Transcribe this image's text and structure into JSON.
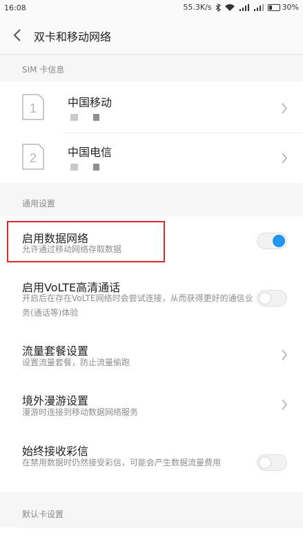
{
  "status_bar": {
    "time": "16:08",
    "speed": "55.3K/s",
    "battery": "30%",
    "battery_level": 0.3,
    "icons": [
      "bluetooth-icon",
      "wifi-icon",
      "signal-icon",
      "signal-4g-icon",
      "battery-icon"
    ]
  },
  "header": {
    "title": "双卡和移动网络"
  },
  "sim_section": {
    "header": "SIM 卡信息",
    "sims": [
      {
        "slot": "1",
        "name": "中国移动"
      },
      {
        "slot": "2",
        "name": "中国电信"
      }
    ]
  },
  "general_section": {
    "header": "通用设置",
    "items": [
      {
        "title": "启用数据网络",
        "desc": "允许通过移动网络存取数据",
        "control": "toggle",
        "on": true
      },
      {
        "title": "启用VoLTE高清通话",
        "desc": "开启后在存在VoLTE网络时会尝试连接，从而获得更好的通信业务(通话等)体验",
        "control": "toggle",
        "on": false
      },
      {
        "title": "流量套餐设置",
        "desc": "设置流量套餐，防止流量偷跑",
        "control": "chevron"
      },
      {
        "title": "境外漫游设置",
        "desc": "漫游时连接到移动数据网络服务",
        "control": "chevron"
      },
      {
        "title": "始终接收彩信",
        "desc": "在禁用数据时仍然接受彩信，可能会产生数据流量费用",
        "control": "toggle",
        "on": false
      }
    ]
  },
  "default_section": {
    "header": "默认卡设置"
  },
  "colors": {
    "accent": "#2196f3",
    "highlight": "#e0262a"
  }
}
